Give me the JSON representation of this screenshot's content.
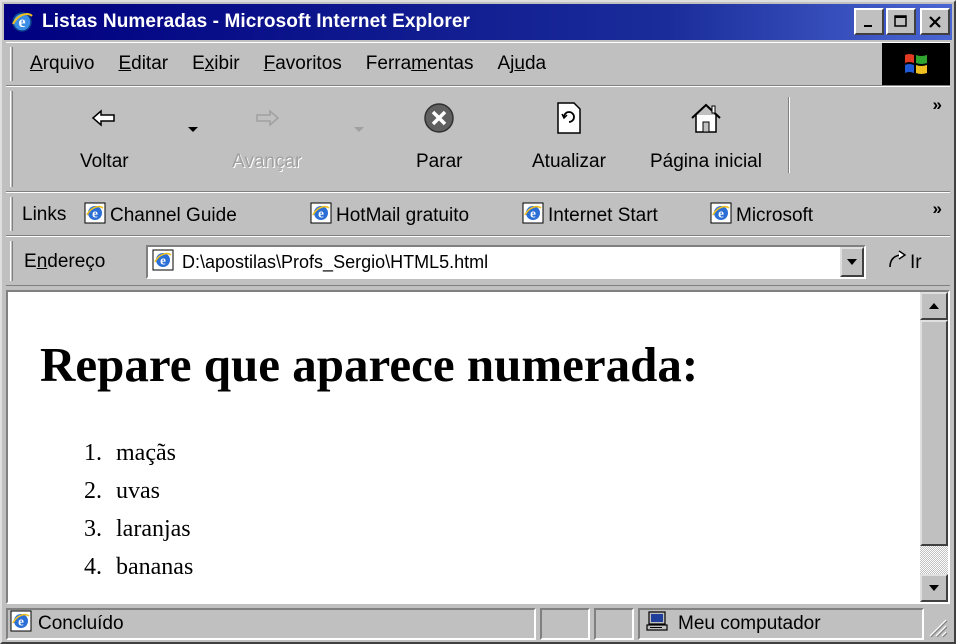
{
  "window": {
    "title": "Listas Numeradas - Microsoft Internet Explorer"
  },
  "menu": [
    {
      "pre": "",
      "key": "A",
      "post": "rquivo"
    },
    {
      "pre": "",
      "key": "E",
      "post": "ditar"
    },
    {
      "pre": "E",
      "key": "x",
      "post": "ibir"
    },
    {
      "pre": "",
      "key": "F",
      "post": "avoritos"
    },
    {
      "pre": "Ferra",
      "key": "m",
      "post": "entas"
    },
    {
      "pre": "Aj",
      "key": "u",
      "post": "da"
    }
  ],
  "toolbar": {
    "back": "Voltar",
    "forward": "Avançar",
    "stop": "Parar",
    "refresh": "Atualizar",
    "home": "Página inicial",
    "more": "»"
  },
  "links": {
    "label": "Links",
    "items": [
      "Channel Guide",
      "HotMail gratuito",
      "Internet Start",
      "Microsoft"
    ],
    "more": "»"
  },
  "address": {
    "label_pre": "E",
    "label_key": "n",
    "label_post": "dereço",
    "value": "D:\\apostilas\\Profs_Sergio\\HTML5.html",
    "go": "Ir"
  },
  "page": {
    "heading": "Repare que aparece numerada:",
    "list": [
      {
        "num": "1.",
        "text": "maçãs"
      },
      {
        "num": "2.",
        "text": "uvas"
      },
      {
        "num": "3.",
        "text": "laranjas"
      },
      {
        "num": "4.",
        "text": "bananas"
      }
    ]
  },
  "status": {
    "text": "Concluído",
    "zone": "Meu computador"
  },
  "colors": {
    "titlebar": "#000080",
    "face": "#c0c0c0",
    "content_bg": "#ffffff"
  }
}
